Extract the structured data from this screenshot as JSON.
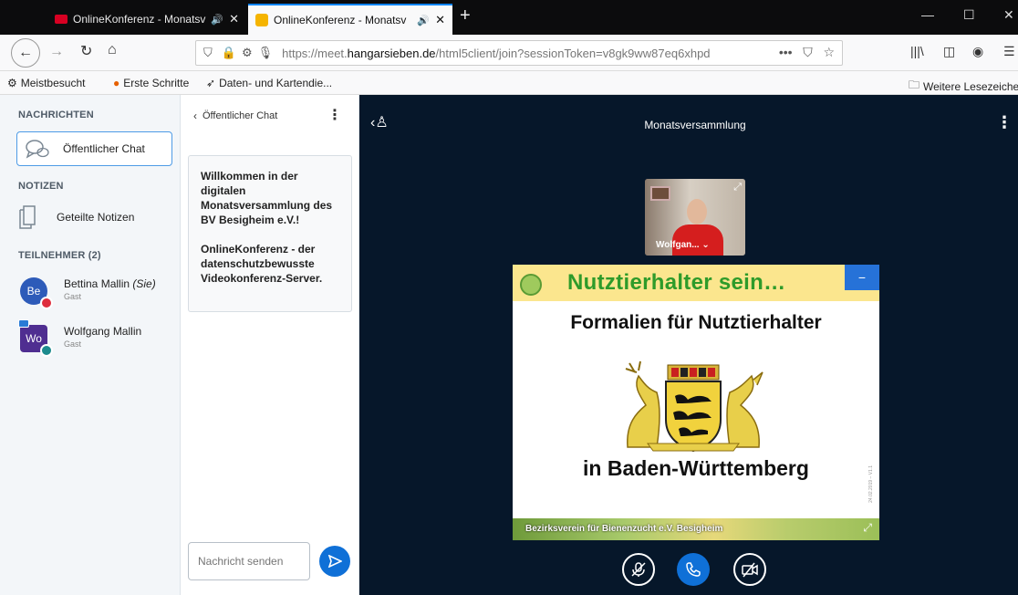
{
  "browser": {
    "tabs": [
      {
        "title": "OnlineKonferenz - Monatsv",
        "active": false
      },
      {
        "title": "OnlineKonferenz - Monatsv",
        "active": true
      }
    ],
    "url": {
      "scheme": "https://meet.",
      "domain": "hangarsieben.de",
      "path": "/html5client/join?sessionToken=v8gk9ww87eq6xhpd"
    },
    "bookmarks": [
      "Meistbesucht",
      "Erste Schritte",
      "Daten- und Kartendie..."
    ],
    "other_bookmarks": "Weitere Lesezeichen"
  },
  "userlist": {
    "messages_title": "NACHRICHTEN",
    "public_chat": "Öffentlicher Chat",
    "notes_title": "NOTIZEN",
    "shared_notes": "Geteilte Notizen",
    "participants_title": "TEILNEHMER (2)",
    "users": [
      {
        "initials": "Be",
        "name": "Bettina Mallin",
        "you_tag": "(Sie)",
        "role": "Gast"
      },
      {
        "initials": "Wo",
        "name": "Wolfgang Mallin",
        "role": "Gast"
      }
    ]
  },
  "chat": {
    "header": "Öffentlicher Chat",
    "welcome_line1": "Willkommen in der digitalen Monatsversammlung des BV Besigheim e.V.!",
    "welcome_line2": "OnlineKonferenz - der datenschutzbewusste Videokonferenz-Server.",
    "input_placeholder": "Nachricht senden"
  },
  "media": {
    "meeting_title": "Monatsversammlung",
    "webcam_name": "Wolfgan... ⌄",
    "slide": {
      "header": "Nutztierhalter sein…",
      "title": "Formalien für Nutztierhalter",
      "subtitle": "in Baden-Württemberg",
      "footer": "Bezirksverein für Bienenzucht e.V. Besigheim",
      "date_note": "24.02.2019 – V1.1"
    }
  },
  "colors": {
    "accent": "#0f70d7",
    "sidebar_bg": "#f3f6f9",
    "media_bg": "#06172a",
    "slide_green": "#2e9b2a"
  }
}
